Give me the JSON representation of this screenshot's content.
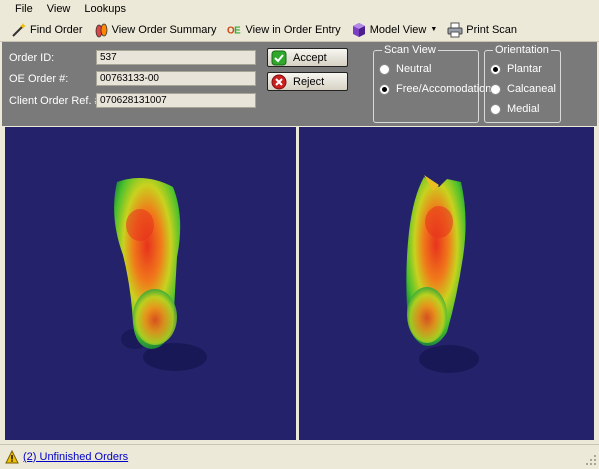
{
  "menu": {
    "items": [
      "File",
      "View",
      "Lookups"
    ]
  },
  "toolbar": {
    "find_order": "Find Order",
    "view_summary": "View Order Summary",
    "view_entry": "View in Order Entry",
    "model_view": "Model View",
    "print_scan": "Print Scan"
  },
  "form": {
    "order_id_label": "Order ID:",
    "order_id_value": "537",
    "oe_order_label": "OE Order #:",
    "oe_order_value": "00763133-00",
    "client_ref_label": "Client Order Ref. #:",
    "client_ref_value": "070628131007"
  },
  "actions": {
    "accept": "Accept",
    "reject": "Reject"
  },
  "scan_view": {
    "title": "Scan View",
    "options": [
      "Neutral",
      "Free/Accomodation"
    ],
    "selected": "Free/Accomodation"
  },
  "orientation": {
    "title": "Orientation",
    "options": [
      "Plantar",
      "Calcaneal",
      "Medial"
    ],
    "selected": "Plantar"
  },
  "status": {
    "link": "(2) Unfinished Orders"
  },
  "colors": {
    "panel_bg": "#7a7a7a",
    "viewport_bg": "#23226a",
    "accent_green": "#2fa82b",
    "reject_red": "#cc2020",
    "link_blue": "#0000c8"
  }
}
